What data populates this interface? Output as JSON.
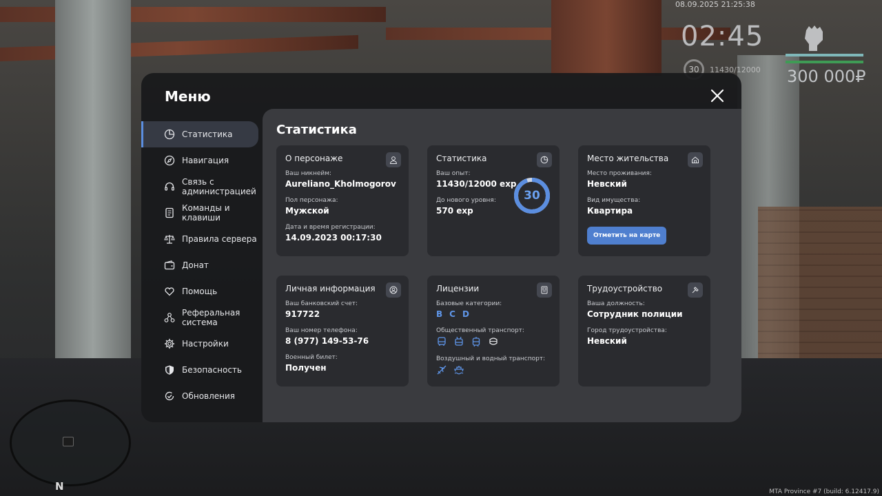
{
  "hud": {
    "datetime": "08.09.2025 21:25:38",
    "time": "02:45",
    "level": "30",
    "exp": "11430/12000",
    "money": "300 000₽",
    "build": "MTA Province #7 (build: 6.12417.9)",
    "radar_north": "N"
  },
  "menu": {
    "title": "Меню",
    "sidebar": [
      {
        "label": "Статистика",
        "icon": "pie-chart-icon",
        "active": true
      },
      {
        "label": "Навигация",
        "icon": "compass-icon"
      },
      {
        "label": "Связь с администрацией",
        "icon": "headset-icon"
      },
      {
        "label": "Команды и клавиши",
        "icon": "document-icon"
      },
      {
        "label": "Правила сервера",
        "icon": "scales-icon"
      },
      {
        "label": "Донат",
        "icon": "wallet-icon"
      },
      {
        "label": "Помощь",
        "icon": "heart-hand-icon"
      },
      {
        "label": "Реферальная система",
        "icon": "network-icon"
      },
      {
        "label": "Настройки",
        "icon": "gear-icon"
      },
      {
        "label": "Безопасность",
        "icon": "shield-icon"
      },
      {
        "label": "Обновления",
        "icon": "check-refresh-icon"
      }
    ]
  },
  "content": {
    "title": "Статистика",
    "character": {
      "title": "О персонаже",
      "nickname_label": "Ваш никнейм:",
      "nickname": "Aureliano_Kholmogorov",
      "gender_label": "Пол персонажа:",
      "gender": "Мужской",
      "reg_label": "Дата и время регистрации:",
      "reg": "14.09.2023 00:17:30"
    },
    "stats": {
      "title": "Статистика",
      "exp_label": "Ваш опыт:",
      "exp": "11430/12000 exp",
      "next_label": "До нового уровня:",
      "next": "570 exp",
      "level": "30",
      "progress": 0.95,
      "accent": "#5b8ee0"
    },
    "residence": {
      "title": "Место жительства",
      "place_label": "Место проживания:",
      "place": "Невский",
      "property_label": "Вид имущества:",
      "property": "Квартира",
      "map_button": "Отметить на карте"
    },
    "personal": {
      "title": "Личная информация",
      "bank_label": "Ваш банковский счет:",
      "bank": "917722",
      "phone_label": "Ваш номер телефона:",
      "phone": "8 (977) 149-53-76",
      "military_label": "Военный билет:",
      "military": "Получен"
    },
    "licenses": {
      "title": "Лицензии",
      "base_label": "Базовые категории:",
      "categories": [
        "B",
        "C",
        "D"
      ],
      "public_label": "Общественный транспорт:",
      "air_label": "Воздушный и водный транспорт:"
    },
    "employment": {
      "title": "Трудоустройство",
      "position_label": "Ваша должность:",
      "position": "Сотрудник полиции",
      "city_label": "Город трудоустройства:",
      "city": "Невский"
    }
  }
}
